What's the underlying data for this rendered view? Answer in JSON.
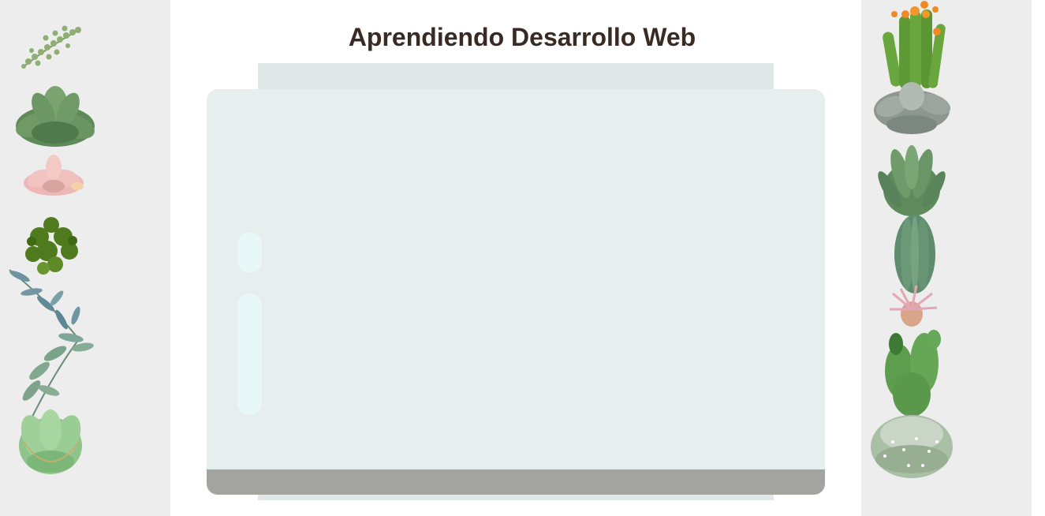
{
  "page": {
    "title": "Aprendiendo Desarrollo Web"
  },
  "left_panel": {
    "plants": [
      "string-of-pearls-plant",
      "green-rosette-succulent",
      "pink-succulent",
      "leafy-bush-plant",
      "eucalyptus-branch",
      "green-echeveria"
    ]
  },
  "right_panel": {
    "plants": [
      "flowering-cactus",
      "grey-echeveria",
      "aloe-succulent",
      "columnar-cactus",
      "air-plant",
      "paddle-cactus",
      "round-fuzzy-cactus"
    ]
  },
  "colors": {
    "side_panel": "#ededed",
    "screen": "#e7eeee",
    "screen_back": "#dfe8e7",
    "screen_base": "#a3a4a0",
    "side_buttons": "#e8f8f8",
    "title": "#3a2a24"
  }
}
